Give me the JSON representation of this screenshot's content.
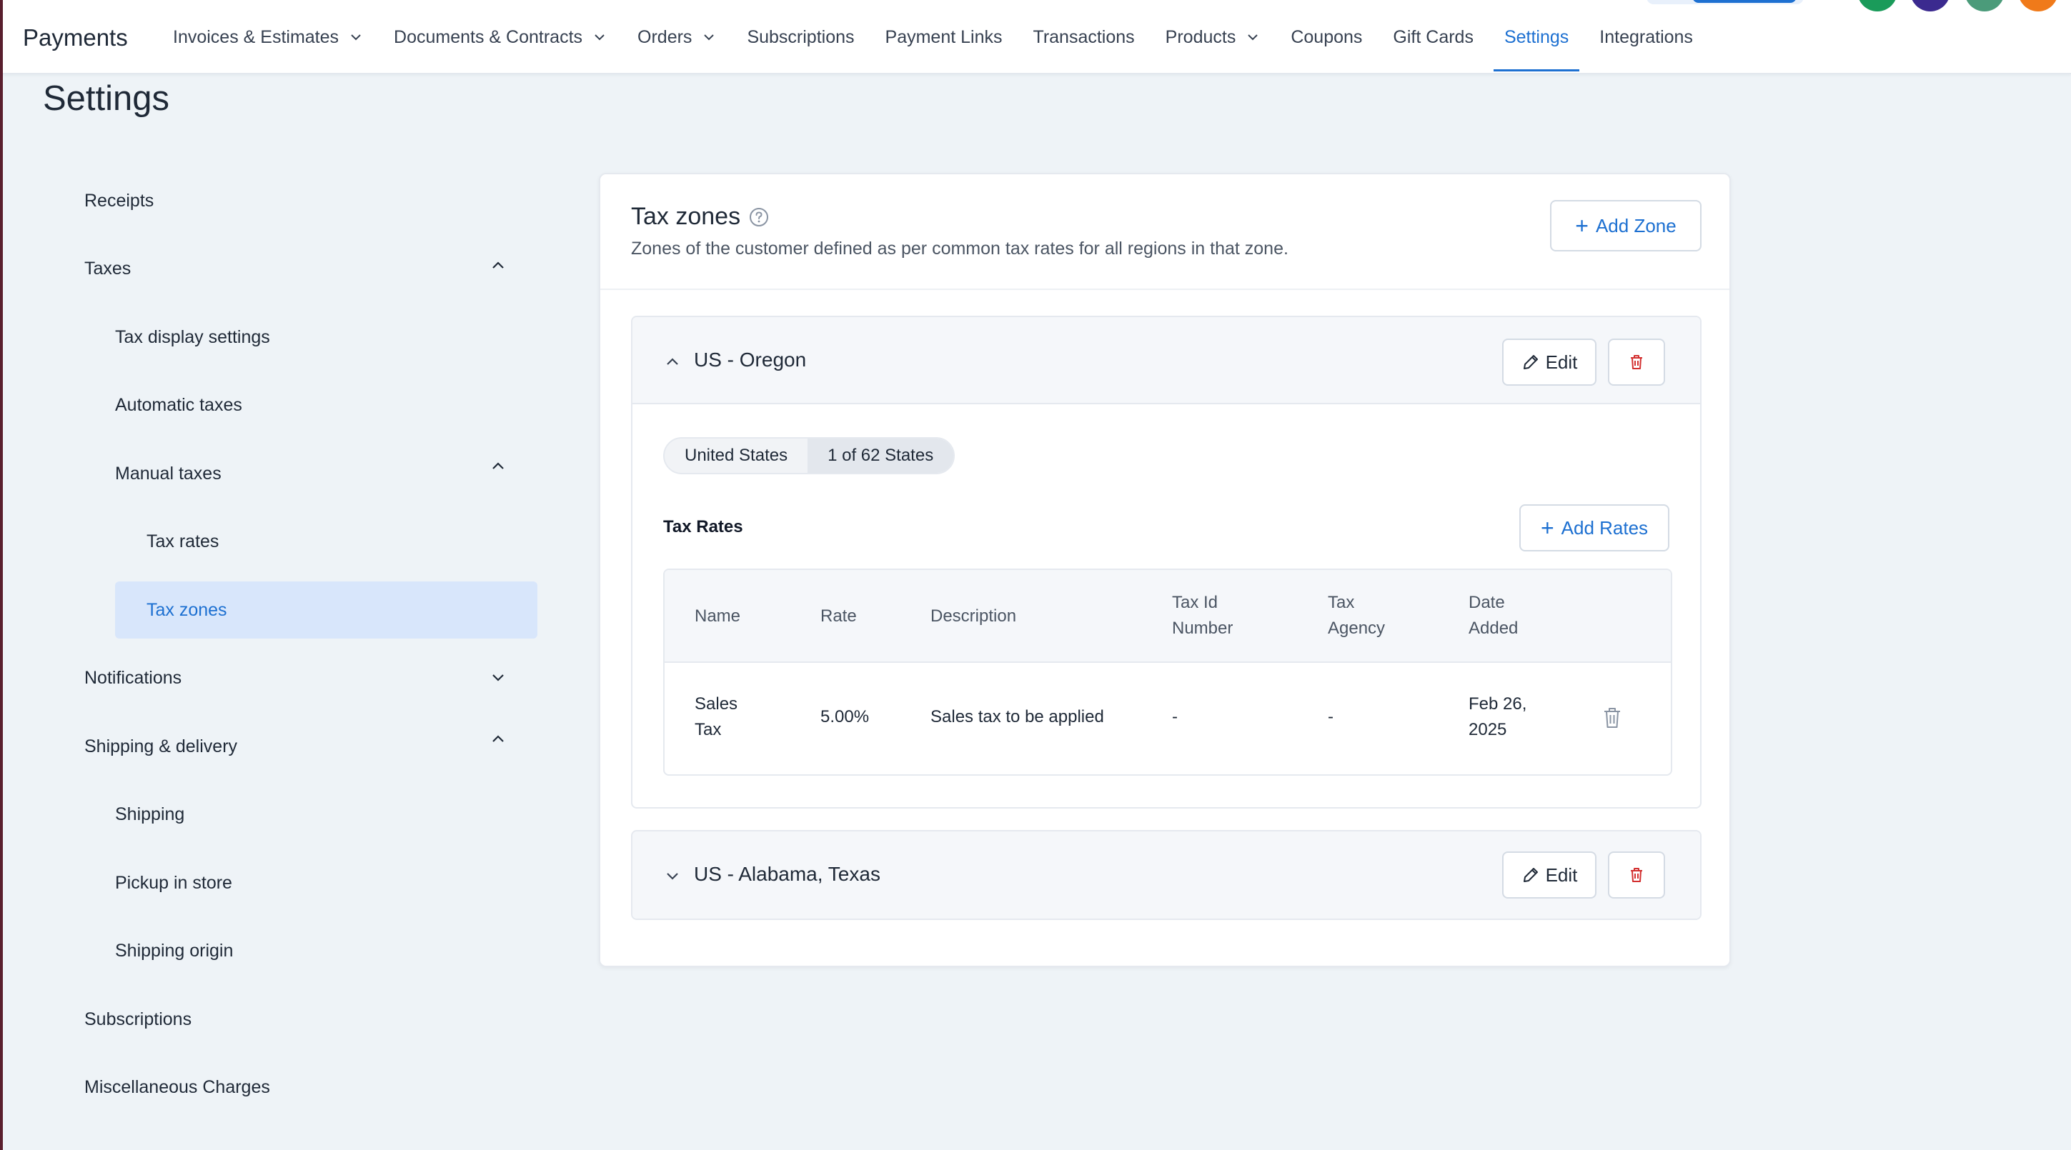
{
  "app": {
    "title": "Payments"
  },
  "nav": [
    {
      "label": "Invoices & Estimates",
      "dropdown": true,
      "active": false
    },
    {
      "label": "Documents & Contracts",
      "dropdown": true,
      "active": false
    },
    {
      "label": "Orders",
      "dropdown": true,
      "active": false
    },
    {
      "label": "Subscriptions",
      "dropdown": false,
      "active": false
    },
    {
      "label": "Payment Links",
      "dropdown": false,
      "active": false
    },
    {
      "label": "Transactions",
      "dropdown": false,
      "active": false
    },
    {
      "label": "Products",
      "dropdown": true,
      "active": false
    },
    {
      "label": "Coupons",
      "dropdown": false,
      "active": false
    },
    {
      "label": "Gift Cards",
      "dropdown": false,
      "active": false
    },
    {
      "label": "Settings",
      "dropdown": false,
      "active": true
    },
    {
      "label": "Integrations",
      "dropdown": false,
      "active": false
    }
  ],
  "page": {
    "title": "Settings"
  },
  "sidebar": {
    "items": [
      {
        "label": "Receipts"
      },
      {
        "label": "Taxes"
      },
      {
        "label": "Tax display settings"
      },
      {
        "label": "Automatic taxes"
      },
      {
        "label": "Manual taxes"
      },
      {
        "label": "Tax rates"
      },
      {
        "label": "Tax zones"
      },
      {
        "label": "Notifications"
      },
      {
        "label": "Shipping & delivery"
      },
      {
        "label": "Shipping"
      },
      {
        "label": "Pickup in store"
      },
      {
        "label": "Shipping origin"
      },
      {
        "label": "Subscriptions"
      },
      {
        "label": "Miscellaneous Charges"
      }
    ]
  },
  "card": {
    "title": "Tax zones",
    "subtitle": "Zones of the customer defined as per common tax rates for all regions in that zone.",
    "add_zone_label": "Add Zone"
  },
  "zones": [
    {
      "name": "US - Oregon",
      "expanded": true,
      "edit_label": "Edit",
      "country_chip": "United States",
      "states_chip": "1 of 62 States",
      "rates_title": "Tax Rates",
      "add_rates_label": "Add Rates",
      "columns": [
        "Name",
        "Rate",
        "Description",
        "Tax Id Number",
        "Tax Agency",
        "Date Added"
      ],
      "rows": [
        {
          "name": "Sales Tax",
          "rate": "5.00%",
          "description": "Sales tax to be applied",
          "tax_id": "-",
          "agency": "-",
          "date": "Feb 26, 2025"
        }
      ]
    },
    {
      "name": "US - Alabama, Texas",
      "expanded": false,
      "edit_label": "Edit"
    }
  ],
  "colors": {
    "accent": "#1d70d1",
    "danger": "#d32f2f",
    "selected_bg": "#d8e6fb"
  }
}
